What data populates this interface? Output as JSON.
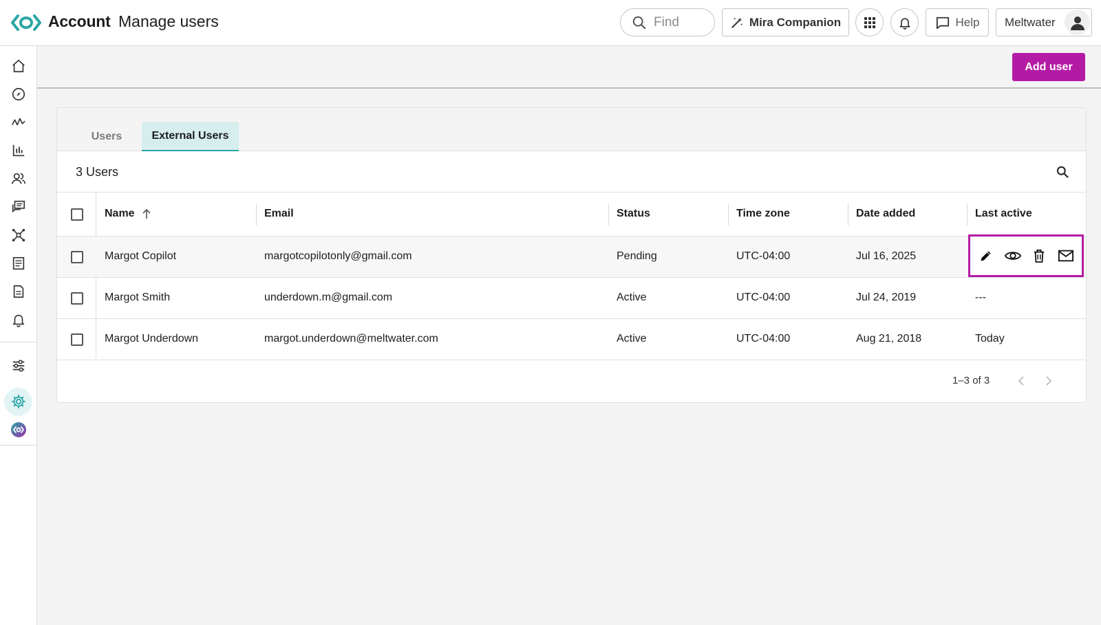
{
  "header": {
    "app_title": "Account",
    "page_title": "Manage users",
    "search_placeholder": "Find",
    "companion_label": "Mira Companion",
    "help_label": "Help",
    "account_name": "Meltwater"
  },
  "toolbar": {
    "add_user_label": "Add user"
  },
  "tabs": [
    {
      "label": "Users",
      "active": false
    },
    {
      "label": "External Users",
      "active": true
    }
  ],
  "table": {
    "count_label": "3 Users",
    "columns": [
      "Name",
      "Email",
      "Status",
      "Time zone",
      "Date added",
      "Last active"
    ],
    "rows": [
      {
        "name": "Margot Copilot",
        "email": "margotcopilotonly@gmail.com",
        "status": "Pending",
        "timezone": "UTC-04:00",
        "date_added": "Jul 16, 2025",
        "last_active": ""
      },
      {
        "name": "Margot Smith",
        "email": "underdown.m@gmail.com",
        "status": "Active",
        "timezone": "UTC-04:00",
        "date_added": "Jul 24, 2019",
        "last_active": "---"
      },
      {
        "name": "Margot Underdown",
        "email": "margot.underdown@meltwater.com",
        "status": "Active",
        "timezone": "UTC-04:00",
        "date_added": "Aug 21, 2018",
        "last_active": "Today"
      }
    ],
    "pagination": "1–3 of 3"
  },
  "icons": {
    "sidebar": [
      "home-icon",
      "compass-icon",
      "analytics-icon",
      "bar-chart-icon",
      "people-icon",
      "conversations-icon",
      "network-icon",
      "newsletter-icon",
      "document-icon",
      "bell-icon",
      "settings-sliders-icon",
      "settings-gear-icon",
      "brand-eye-icon"
    ],
    "row_actions": [
      "edit-icon",
      "view-icon",
      "delete-icon",
      "mail-icon"
    ]
  },
  "colors": {
    "brand_teal": "#2ba6a6",
    "accent_magenta": "#b41ba5",
    "active_tab_bg": "#d7eeee"
  }
}
